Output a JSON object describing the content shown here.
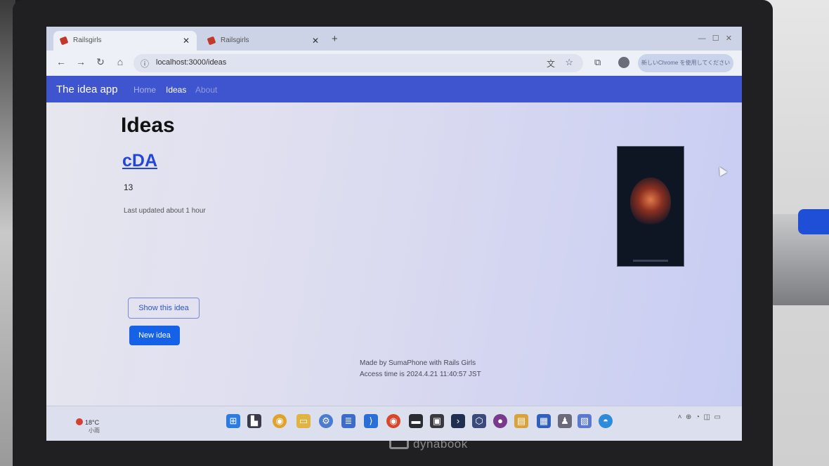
{
  "browser": {
    "tabs": [
      {
        "label": "Railsgirls",
        "active": true
      },
      {
        "label": "Railsgirls",
        "active": false
      }
    ],
    "new_tab": "+",
    "close_glyph": "✕",
    "url": "localhost:3000/ideas",
    "update_button": "新しいChrome を使用してください"
  },
  "app": {
    "brand": "The idea app",
    "nav": [
      {
        "label": "Home"
      },
      {
        "label": "Ideas"
      },
      {
        "label": "About"
      }
    ]
  },
  "page": {
    "title": "Ideas",
    "idea": {
      "name": "cDA",
      "description": "13",
      "updated": "Last updated about 1 hour"
    },
    "show_button": "Show this idea",
    "new_button": "New idea",
    "footer_line1": "Made by SumaPhone with Rails Girls",
    "footer_line2": "Access time is 2024.4.21 11:40:57 JST"
  },
  "taskbar": {
    "weather_temp": "18°C",
    "weather_desc": "小雨",
    "icons": [
      "windows-start-icon",
      "task-view-icon",
      "chrome-icon",
      "file-explorer-icon",
      "settings-icon",
      "notepad-icon",
      "vscode-icon",
      "chrome-profile-icon",
      "terminal-icon",
      "app-icon",
      "powershell-icon",
      "box-icon",
      "app-icon-2",
      "folder-icon",
      "app-icon-3",
      "app-icon-4",
      "files-icon",
      "app-icon-5"
    ]
  },
  "device": {
    "brand": "dynabook"
  },
  "colors": {
    "navbar": "#3f55cf",
    "link": "#2446d8",
    "primary_button": "#1561e8"
  }
}
